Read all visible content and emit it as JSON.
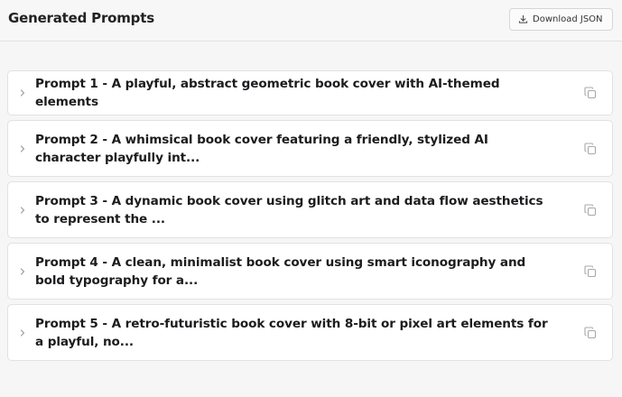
{
  "header": {
    "title": "Generated Prompts",
    "download_label": "Download JSON"
  },
  "prompts": [
    {
      "label": "Prompt 1 - A playful, abstract geometric book cover with AI-themed elements"
    },
    {
      "label": "Prompt 2 - A whimsical book cover featuring a friendly, stylized AI character playfully int..."
    },
    {
      "label": "Prompt 3 - A dynamic book cover using glitch art and data flow aesthetics to represent the ..."
    },
    {
      "label": "Prompt 4 - A clean, minimalist book cover using smart iconography and bold typography for a..."
    },
    {
      "label": "Prompt 5 - A retro-futuristic book cover with 8-bit or pixel art elements for a playful, no..."
    }
  ],
  "icons": {
    "download": "download-icon",
    "chevron": "chevron-right-icon",
    "copy": "copy-icon"
  }
}
